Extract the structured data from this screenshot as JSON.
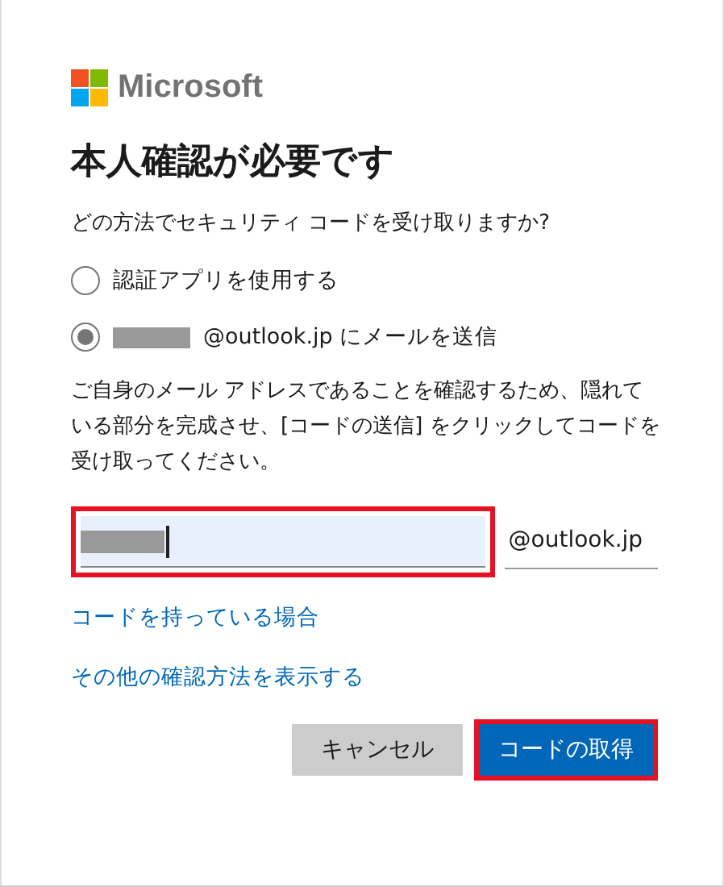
{
  "brand": {
    "name": "Microsoft"
  },
  "title": "本人確認が必要です",
  "question": "どの方法でセキュリティ コードを受け取りますか?",
  "options": [
    {
      "label": "認証アプリを使用する",
      "redacted_prefix": false,
      "selected": false
    },
    {
      "label": "@outlook.jp にメールを送信",
      "redacted_prefix": true,
      "selected": true
    }
  ],
  "instructions": "ご自身のメール アドレスであることを確認するため、隠れている部分を完成させ、[コードの送信] をクリックしてコードを受け取ってください。",
  "email_field": {
    "redacted_value": true,
    "focused": true,
    "highlighted": true,
    "suffix": "@outlook.jp"
  },
  "links": [
    "コードを持っている場合",
    "その他の確認方法を表示する"
  ],
  "buttons": [
    {
      "label": "キャンセル",
      "kind": "secondary",
      "highlighted": false
    },
    {
      "label": "コードの取得",
      "kind": "primary",
      "highlighted": true
    }
  ]
}
